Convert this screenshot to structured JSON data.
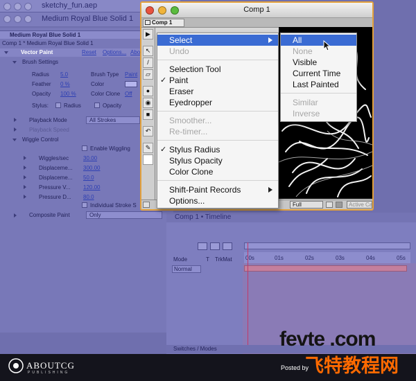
{
  "back_window": {
    "project_title": "sketchy_fun.aep",
    "layer_window_title": "Medium Royal Blue Solid 1",
    "effect_controls_tab": "Medium Royal Blue Solid 1",
    "breadcrumb": "Comp 1 * Medium Royal Blue Solid 1",
    "effect_name": "Vector Paint",
    "effect_reset": "Reset",
    "effect_options": "Options...",
    "effect_about": "About...",
    "brush_settings": "Brush Settings",
    "radius_label": "Radius",
    "radius_value": "5.0",
    "brush_type_label": "Brush Type",
    "brush_type_value": "Paint",
    "feather_label": "Feather",
    "feather_value": "0 %",
    "color_label": "Color",
    "opacity_label": "Opacity",
    "opacity_value": "100 %",
    "color_clone_label": "Color Clone",
    "color_clone_value": "Off",
    "stylus_label": "Stylus:",
    "stylus_radius": "Radius",
    "stylus_opacity": "Opacity",
    "playback_mode_label": "Playback Mode",
    "playback_mode_value": "All Strokes",
    "playback_speed_label": "Playback Speed",
    "wiggle_control": "Wiggle Control",
    "enable_wiggling": "Enable Wiggling",
    "wiggles_label": "Wiggles/sec",
    "wiggles_value": "30.00",
    "displace1_label": "Displaceme...",
    "displace1_value": "300.00",
    "displace2_label": "Displaceme...",
    "displace2_value": "50.0",
    "pressure1_label": "Pressure V...",
    "pressure1_value": "120.00",
    "pressure2_label": "Pressure D...",
    "pressure2_value": "80.0",
    "individual_stroke": "Individual Stroke S",
    "composite_paint_label": "Composite Paint",
    "composite_paint_value": "Only",
    "timeline_title": "Comp 1 • Timeline",
    "col_mode": "Mode",
    "col_t": "T",
    "col_trkmat": "TrkMat",
    "mode_value": "Normal",
    "ticks": [
      "00s",
      "01s",
      "02s",
      "03s",
      "04s",
      "05s"
    ],
    "switches_modes": "Switches / Modes"
  },
  "comp_window": {
    "title": "Comp 1",
    "tab_label": "Comp 1",
    "zoom_value": "Full",
    "active_camera": "Active Camera"
  },
  "main_menu": {
    "items": {
      "select": "Select",
      "undo": "Undo",
      "selection_tool": "Selection Tool",
      "paint": "Paint",
      "eraser": "Eraser",
      "eyedropper": "Eyedropper",
      "smoother": "Smoother...",
      "retimer": "Re-timer...",
      "stylus_radius": "Stylus Radius",
      "stylus_opacity": "Stylus Opacity",
      "color_clone": "Color Clone",
      "shift_paint": "Shift-Paint Records",
      "options": "Options..."
    }
  },
  "sub_menu": {
    "all": "All",
    "none": "None",
    "visible": "Visible",
    "current_time": "Current Time",
    "last_painted": "Last Painted",
    "similar": "Similar",
    "inverse": "Inverse"
  },
  "footer": {
    "logo": "ABOUTCG",
    "logo_sub": "PUBLISHING",
    "posted": "Posted by",
    "watermark": "fevte .com",
    "watermark_cn": "飞特教程网"
  },
  "colors": {
    "menu_highlight": "#3a6bd3",
    "comp_border": "#e3a13b",
    "watermark_cn": "#ff6a00"
  }
}
